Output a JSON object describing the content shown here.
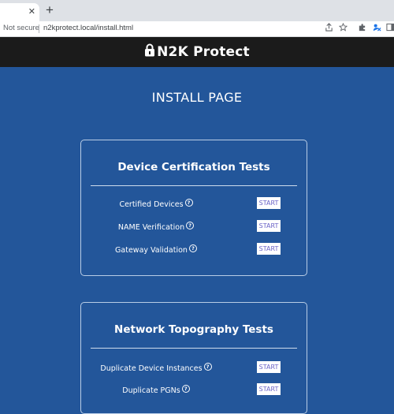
{
  "browser": {
    "close_glyph": "✕",
    "new_tab_glyph": "+",
    "security_label": "Not secure",
    "url": "n2kprotect.local/install.html",
    "toolbar_icons": [
      "share-icon",
      "star-icon",
      "extensions-icon",
      "profile-icon",
      "sidepanel-icon"
    ]
  },
  "site": {
    "brand": "N2K Protect"
  },
  "page": {
    "title": "INSTALL PAGE"
  },
  "sections": [
    {
      "title": "Device Certification Tests",
      "tests": [
        {
          "label": "Certified Devices",
          "button": "START"
        },
        {
          "label": "NAME Verification",
          "button": "START"
        },
        {
          "label": "Gateway Validation",
          "button": "START"
        }
      ]
    },
    {
      "title": "Network Topography Tests",
      "tests": [
        {
          "label": "Duplicate Device Instances",
          "button": "START"
        },
        {
          "label": "Duplicate PGNs",
          "button": "START"
        }
      ]
    }
  ],
  "help_glyph": "?",
  "colors": {
    "page_bg": "#23569a",
    "header_bg": "#1b1b1b",
    "button_text": "#6b63c7"
  }
}
